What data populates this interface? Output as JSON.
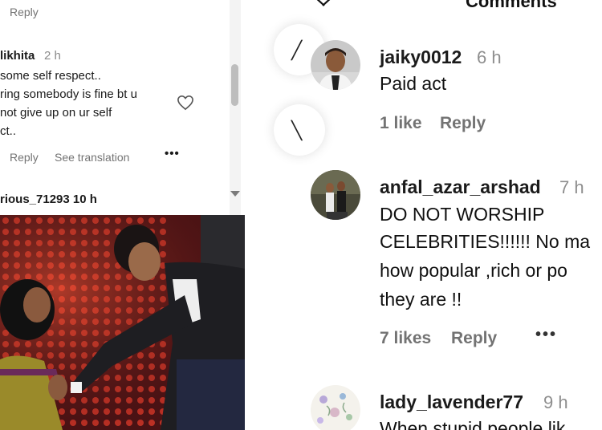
{
  "left_panel": {
    "top_reply": "Reply",
    "comment": {
      "username": "likhita",
      "time": "2 h",
      "lines": [
        "some self respect..",
        "ring somebody is fine bt u",
        "not give up on ur self",
        "ct.."
      ],
      "reply_label": "Reply",
      "translate_label": "See translation",
      "more_label": "•••"
    },
    "next_comment_username": "rious_71293  10 h"
  },
  "right_panel": {
    "title": "Comments",
    "bubble_glyphs": [
      "╱",
      "╲"
    ],
    "comments": [
      {
        "username": "jaiky0012",
        "time": "6 h",
        "lines": [
          "Paid act"
        ],
        "likes": "1 like",
        "reply": "Reply"
      },
      {
        "username": "anfal_azar_arshad",
        "time": "7 h",
        "lines": [
          "DO NOT WORSHIP",
          "CELEBRITIES!!!!!! No ma",
          "how popular ,rich or po",
          "they are !!"
        ],
        "likes": "7 likes",
        "reply": "Reply",
        "more": "•••"
      },
      {
        "username": "lady_lavender77",
        "time": "9 h",
        "lines": [
          "When stupid people lik"
        ]
      }
    ]
  },
  "colors": {
    "muted_text": "#8e8e8e",
    "action_text": "#737373",
    "photo_background": "#3b0e10",
    "accent_red": "#c81d25"
  },
  "icons": {
    "heart": "heart-outline-icon",
    "close": "close-icon",
    "more": "more-options-icon"
  }
}
